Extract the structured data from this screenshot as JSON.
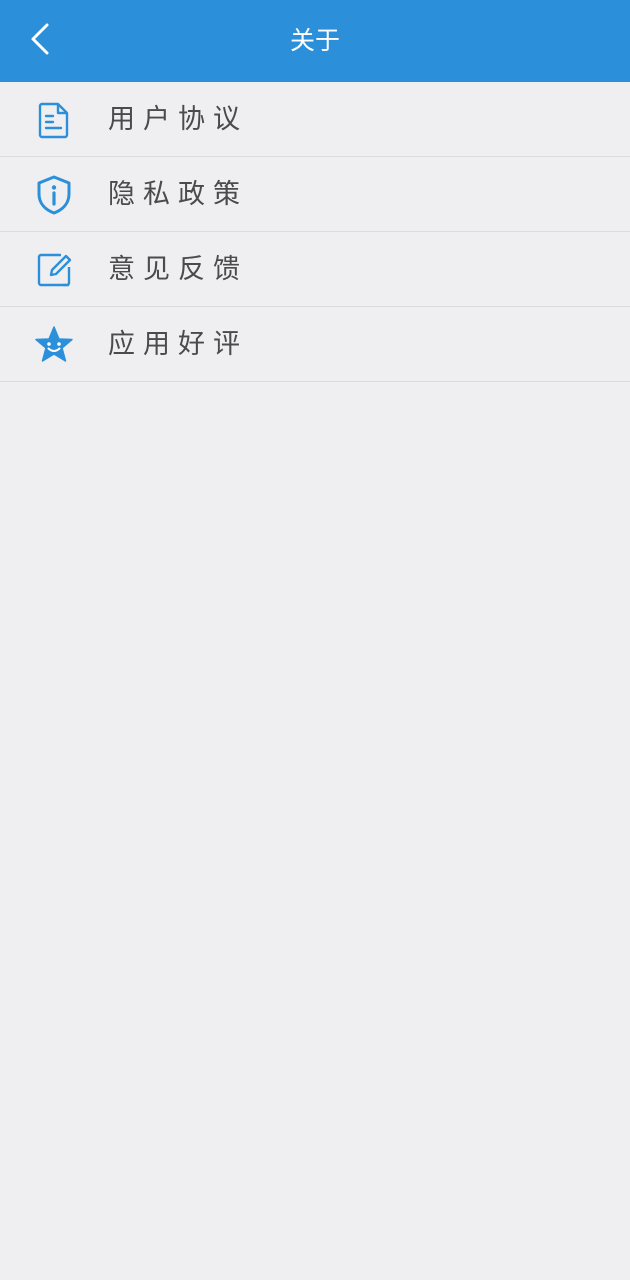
{
  "header": {
    "title": "关于",
    "back_icon": "chevron-left-icon",
    "background": "#2b90d9"
  },
  "menu": {
    "items": [
      {
        "label": "用户协议",
        "icon": "document-icon"
      },
      {
        "label": "隐私政策",
        "icon": "shield-info-icon"
      },
      {
        "label": "意见反馈",
        "icon": "edit-icon"
      },
      {
        "label": "应用好评",
        "icon": "star-icon"
      }
    ]
  },
  "colors": {
    "accent": "#2b90d9",
    "page_background": "#efeff2",
    "label_text": "#4b4b4f"
  }
}
